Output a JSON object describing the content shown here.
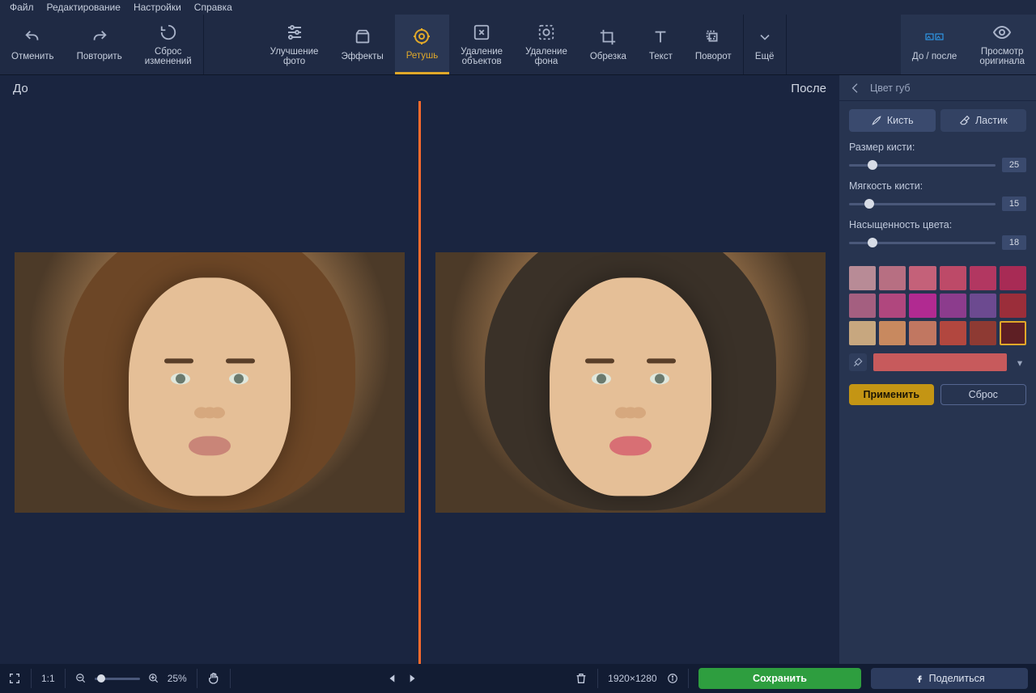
{
  "menu": {
    "items": [
      "Файл",
      "Редактирование",
      "Настройки",
      "Справка"
    ]
  },
  "toolbar": {
    "undo": "Отменить",
    "redo": "Повторить",
    "reset": "Сброс\nизменений",
    "enhance": "Улучшение\nфото",
    "effects": "Эффекты",
    "retouch": "Ретушь",
    "removeObjects": "Удаление\nобъектов",
    "removeBg": "Удаление\nфона",
    "crop": "Обрезка",
    "text": "Текст",
    "rotate": "Поворот",
    "more": "Ещё",
    "beforeAfter": "До / после",
    "viewOriginal": "Просмотр\nоригинала"
  },
  "canvas": {
    "before": "До",
    "after": "После"
  },
  "panel": {
    "title": "Цвет губ",
    "brush": "Кисть",
    "eraser": "Ластик",
    "sizeLabel": "Размер кисти:",
    "sizeVal": "25",
    "softLabel": "Мягкость кисти:",
    "softVal": "15",
    "satLabel": "Насыщенность цвета:",
    "satVal": "18",
    "swatches": [
      "#b88b96",
      "#b76f82",
      "#c46179",
      "#bd4a68",
      "#b23761",
      "#a82b55",
      "#a45f80",
      "#b0477e",
      "#b12a91",
      "#8c3c8d",
      "#6c4a90",
      "#9b2e3a",
      "#c7a77f",
      "#c8895f",
      "#c17761",
      "#b2473f",
      "#8e3a33",
      "#5e1f24"
    ],
    "selectedSwatch": 17,
    "currentColor": "#c75a5c",
    "apply": "Применить",
    "cancel": "Сброс"
  },
  "footer": {
    "oneToOne": "1:1",
    "zoom": "25%",
    "dims": "1920×1280",
    "save": "Сохранить",
    "share": "Поделиться"
  }
}
